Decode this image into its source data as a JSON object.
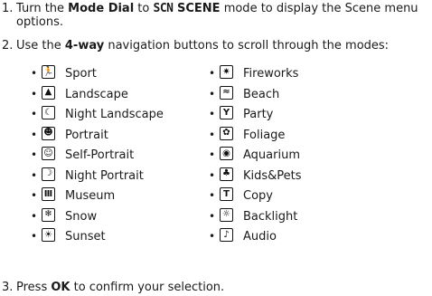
{
  "steps": {
    "s1": {
      "num": "1.",
      "t1": "Turn the ",
      "b1": "Mode Dial",
      "t2": " to ",
      "scn": "SCN",
      "b2": " SCENE",
      "t3": " mode to display the Scene menu options."
    },
    "s2": {
      "num": "2.",
      "t1": "Use the ",
      "b1": "4-way",
      "t2": " navigation buttons to scroll through the modes:"
    },
    "s3": {
      "num": "3.",
      "t1": "Press ",
      "b1": "OK",
      "t2": " to confirm your selection."
    }
  },
  "bullet": "•",
  "left_modes": [
    {
      "label": "Sport",
      "icon": "sport-icon",
      "glyph": "🏃"
    },
    {
      "label": "Landscape",
      "icon": "landscape-icon",
      "glyph": "▲"
    },
    {
      "label": "Night Landscape",
      "icon": "night-landscape-icon",
      "glyph": "☾"
    },
    {
      "label": "Portrait",
      "icon": "portrait-icon",
      "glyph": "☻"
    },
    {
      "label": "Self-Portrait",
      "icon": "self-portrait-icon",
      "glyph": "☺"
    },
    {
      "label": "Night Portrait",
      "icon": "night-portrait-icon",
      "glyph": "☽"
    },
    {
      "label": "Museum",
      "icon": "museum-icon",
      "glyph": "Ⅲ"
    },
    {
      "label": "Snow",
      "icon": "snow-icon",
      "glyph": "❄"
    },
    {
      "label": "Sunset",
      "icon": "sunset-icon",
      "glyph": "☀"
    }
  ],
  "right_modes": [
    {
      "label": "Fireworks",
      "icon": "fireworks-icon",
      "glyph": "✷"
    },
    {
      "label": "Beach",
      "icon": "beach-icon",
      "glyph": "≈"
    },
    {
      "label": "Party",
      "icon": "party-icon",
      "glyph": "Y"
    },
    {
      "label": "Foliage",
      "icon": "foliage-icon",
      "glyph": "✿"
    },
    {
      "label": "Aquarium",
      "icon": "aquarium-icon",
      "glyph": "◉"
    },
    {
      "label": "Kids&Pets",
      "icon": "kids-pets-icon",
      "glyph": "♣"
    },
    {
      "label": "Copy",
      "icon": "copy-icon",
      "glyph": "T"
    },
    {
      "label": "Backlight",
      "icon": "backlight-icon",
      "glyph": "☼"
    },
    {
      "label": "Audio",
      "icon": "audio-icon",
      "glyph": "♪"
    }
  ]
}
